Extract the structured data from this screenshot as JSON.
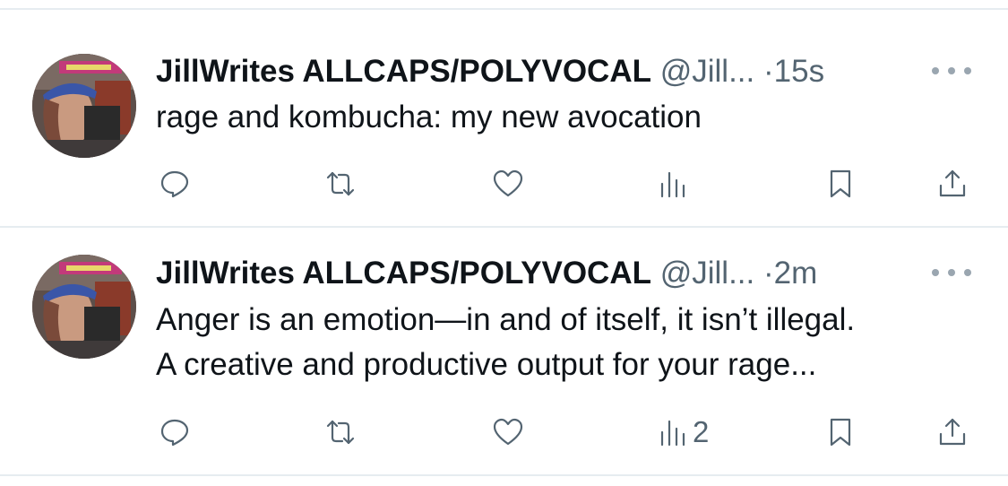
{
  "tweets": [
    {
      "display_name": "JillWrites ALLCAPS/POLYVOCAL",
      "handle": "@Jill...",
      "separator": "·",
      "time": "15s",
      "text_lines": [
        "rage and kombucha: my new avocation"
      ],
      "actions": {
        "reply_icon": "reply-icon",
        "retweet_icon": "retweet-icon",
        "like_icon": "heart-icon",
        "views_icon": "views-chart-icon",
        "views_count": "",
        "bookmark_icon": "bookmark-icon",
        "share_icon": "share-icon"
      }
    },
    {
      "display_name": "JillWrites ALLCAPS/POLYVOCAL",
      "handle": "@Jill...",
      "separator": "·",
      "time": "2m",
      "text_lines": [
        "Anger is an emotion—in and of itself, it isn’t illegal.",
        "A creative and productive output for your rage..."
      ],
      "actions": {
        "reply_icon": "reply-icon",
        "retweet_icon": "retweet-icon",
        "like_icon": "heart-icon",
        "views_icon": "views-chart-icon",
        "views_count": "2",
        "bookmark_icon": "bookmark-icon",
        "share_icon": "share-icon"
      }
    }
  ],
  "colors": {
    "text_primary": "#0f1419",
    "text_secondary": "#536471",
    "divider": "#e6ecf0"
  }
}
